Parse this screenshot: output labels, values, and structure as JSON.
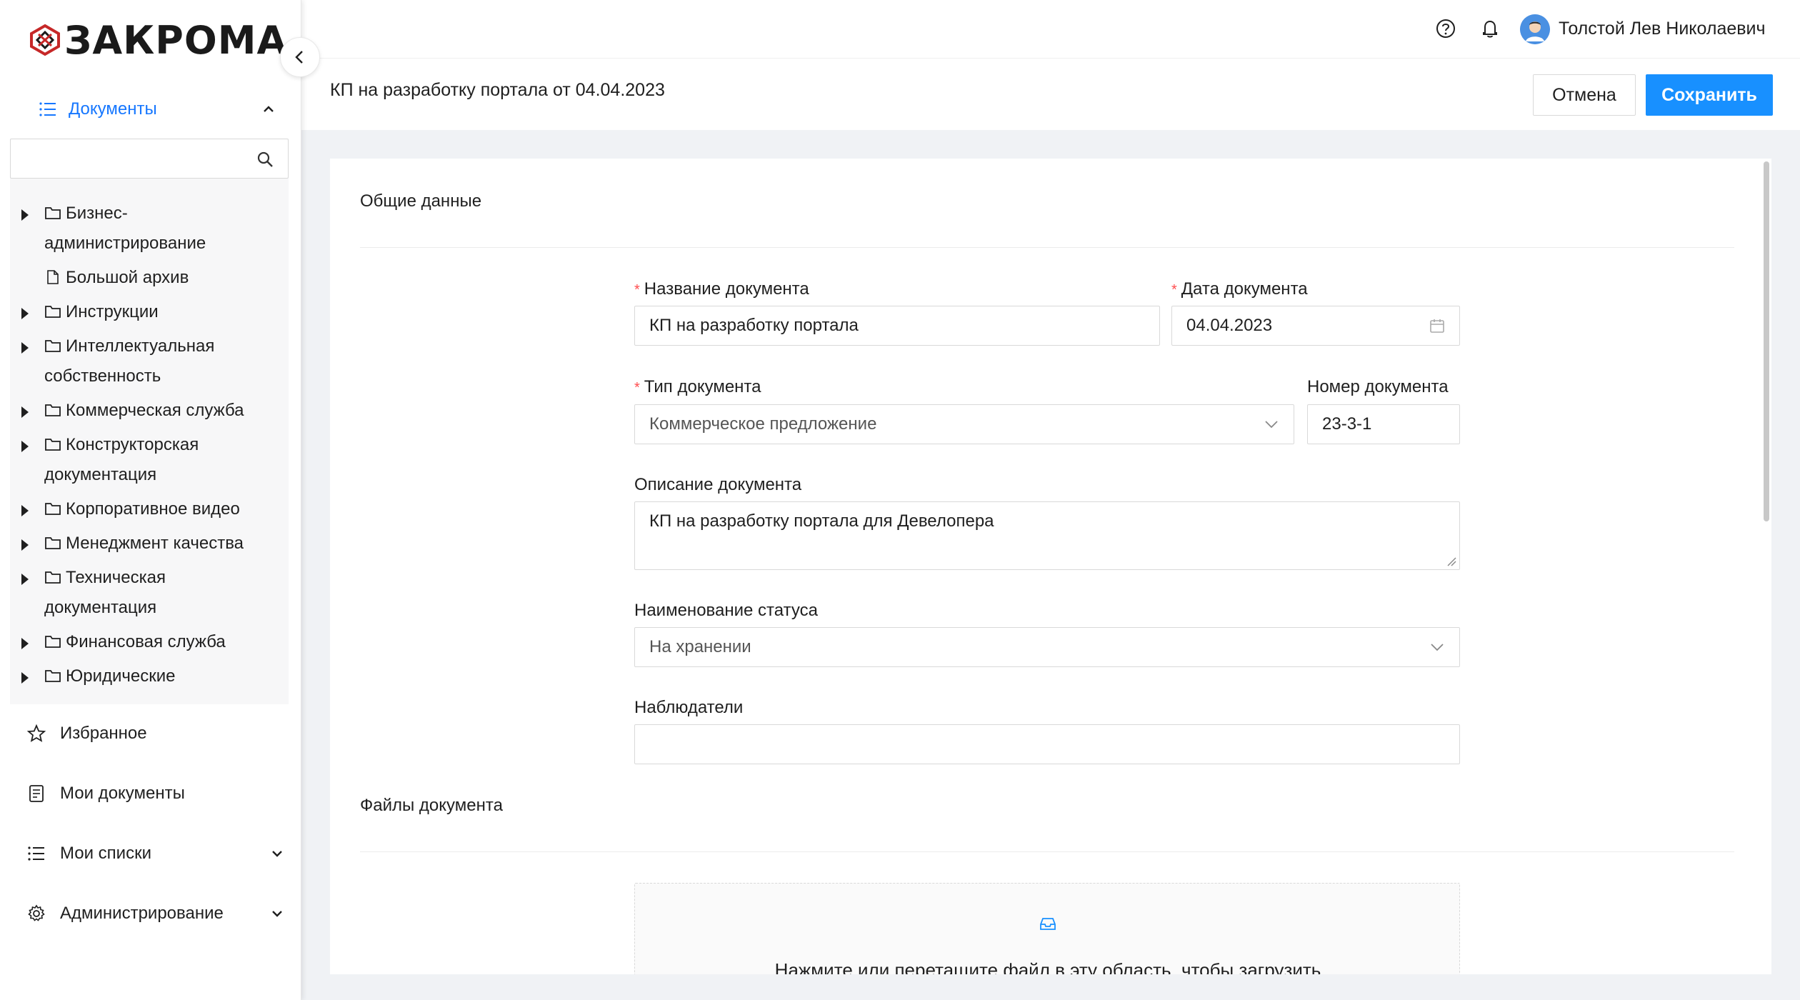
{
  "brand": {
    "logo_text": "ЗАКРОМА"
  },
  "sidebar": {
    "documents_label": "Документы",
    "search_value": "",
    "tree": [
      {
        "label": "Бизнес-администрирование",
        "type": "folder",
        "expandable": true
      },
      {
        "label": "Большой архив",
        "type": "file",
        "expandable": false
      },
      {
        "label": "Инструкции",
        "type": "folder",
        "expandable": true
      },
      {
        "label": "Интеллектуальная собственность",
        "type": "folder",
        "expandable": true
      },
      {
        "label": "Коммерческая служба",
        "type": "folder",
        "expandable": true
      },
      {
        "label": "Конструкторская документация",
        "type": "folder",
        "expandable": true
      },
      {
        "label": "Корпоративное видео",
        "type": "folder",
        "expandable": true
      },
      {
        "label": "Менеджмент качества",
        "type": "folder",
        "expandable": true
      },
      {
        "label": "Техническая документация",
        "type": "folder",
        "expandable": true
      },
      {
        "label": "Финансовая служба",
        "type": "folder",
        "expandable": true
      },
      {
        "label": "Юридические",
        "type": "folder",
        "expandable": true
      }
    ],
    "menu": {
      "favorites": "Избранное",
      "my_documents": "Мои документы",
      "my_lists": "Мои списки",
      "administration": "Администрирование"
    }
  },
  "header": {
    "icons": [
      "help-icon",
      "bell-icon"
    ],
    "user_name": "Толстой Лев Николаевич"
  },
  "page": {
    "title": "КП на разработку портала от 04.04.2023",
    "cancel_label": "Отмена",
    "save_label": "Сохранить"
  },
  "form": {
    "general_section": "Общие данные",
    "doc_name_label": "Название документа",
    "doc_name_value": "КП на разработку портала",
    "doc_date_label": "Дата документа",
    "doc_date_value": "04.04.2023",
    "doc_type_label": "Тип документа",
    "doc_type_value": "Коммерческое предложение",
    "doc_number_label": "Номер документа",
    "doc_number_value": "23-3-1",
    "description_label": "Описание документа",
    "description_value": "КП на разработку портала для Девелопера",
    "status_label": "Наименование статуса",
    "status_value": "На хранении",
    "observers_label": "Наблюдатели",
    "observers_value": "",
    "files_section": "Файлы документа",
    "dropzone_text": "Нажмите или перетащите файл в эту область, чтобы загрузить"
  },
  "colors": {
    "accent": "#1890ff",
    "required": "#ff4d4f",
    "background": "#f0f2f5"
  }
}
